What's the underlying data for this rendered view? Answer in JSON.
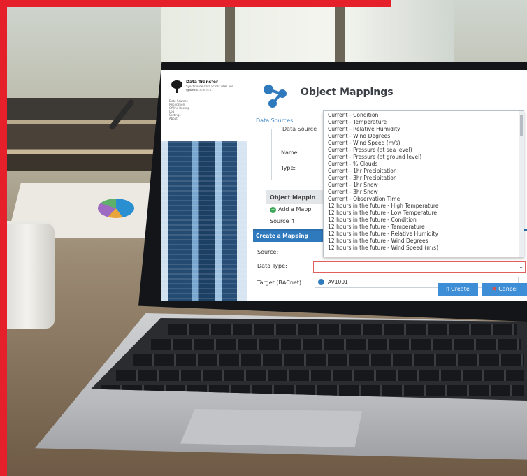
{
  "app": {
    "brand_title": "Data Transfer",
    "brand_subtitle": "Synchronize data across sites and systems",
    "brand_version": "Version: 4.30.8.76.41",
    "nav": [
      "Data Sources",
      "Replication",
      "Offline Backup",
      "Log",
      "Settings",
      "About"
    ]
  },
  "page": {
    "title": "Object Mappings"
  },
  "data_sources": {
    "heading": "Data Sources",
    "legend": "Data Source",
    "name_label": "Name:",
    "type_label": "Type:"
  },
  "object_mappings": {
    "bar_label": "Object Mappin",
    "add_label": "Add a Mappi",
    "source_col": "Source ↑"
  },
  "modal": {
    "title": "Create a Mapping",
    "source_label": "Source:",
    "data_type_label": "Data Type:",
    "target_label": "Target (BACnet):",
    "target_value": "AV1001",
    "create_label": "Create",
    "cancel_label": "Cancel"
  },
  "dropdown_options": [
    "Current - Condition",
    "Current - Temperature",
    "Current - Relative Humidity",
    "Current - Wind Degrees",
    "Current - Wind Speed (m/s)",
    "Current - Pressure (at sea level)",
    "Current - Pressure (at ground level)",
    "Current - % Clouds",
    "Current - 1hr Precipitation",
    "Current - 3hr Precipitation",
    "Current - 1hr Snow",
    "Current - 3hr Snow",
    "Current - Observation Time",
    "12 hours in the future - High Temperature",
    "12 hours in the future - Low Temperature",
    "12 hours in the future - Condition",
    "12 hours in the future - Temperature",
    "12 hours in the future - Relative Humidity",
    "12 hours in the future - Wind Degrees",
    "12 hours in the future - Wind Speed (m/s)"
  ],
  "colors": {
    "accent": "#2f79bd",
    "brand_red": "#e5202b",
    "select_border": "#e06060"
  },
  "icons": [
    "logo-tree-icon",
    "object-mappings-icon",
    "add-icon",
    "bacnet-icon",
    "create-icon",
    "cancel-icon"
  ]
}
